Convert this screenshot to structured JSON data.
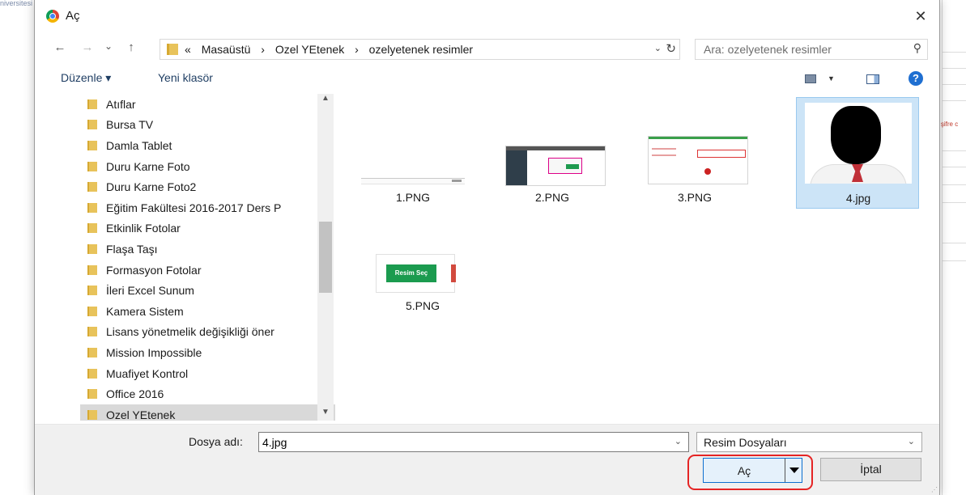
{
  "background": {
    "title": "niversitesi - Özel Yetenek Başvuru Sistemi",
    "cut_text": "r şifre c"
  },
  "dialog": {
    "title": "Aç",
    "close_glyph": "✕",
    "nav": {
      "back": "←",
      "forward": "→",
      "recent": "⌄",
      "up": "↑"
    },
    "address": {
      "prefix": "«",
      "crumbs": [
        "Masaüstü",
        "›",
        "Ozel YEtenek",
        "›",
        "ozelyetenek resimler"
      ],
      "dropdown_glyph": "⌄",
      "refresh_glyph": "↻"
    },
    "search": {
      "placeholder": "Ara: ozelyetenek resimler",
      "icon_glyph": "⚲"
    },
    "toolbar": {
      "organize": "Düzenle ▾",
      "new_folder": "Yeni klasör",
      "help": "?"
    },
    "tree": [
      "Atıflar",
      "Bursa TV",
      "Damla Tablet",
      "Duru Karne Foto",
      "Duru Karne Foto2",
      "Eğitim Fakültesi 2016-2017 Ders P",
      "Etkinlik Fotolar",
      "Flaşa Taşı",
      "Formasyon Fotolar",
      "İleri Excel Sunum",
      "Kamera Sistem",
      "Lisans yönetmelik değişikliği öner",
      "Mission Impossible",
      "Muafiyet Kontrol",
      "Office 2016",
      "Ozel YEtenek"
    ],
    "selected_folder": "Ozel YEtenek",
    "files": [
      {
        "name": "1.PNG"
      },
      {
        "name": "2.PNG"
      },
      {
        "name": "3.PNG"
      },
      {
        "name": "4.jpg",
        "selected": true
      },
      {
        "name": "5.PNG",
        "thumb_text": "Resim Seç"
      }
    ],
    "bottom": {
      "filename_label": "Dosya adı:",
      "filename_value": "4.jpg",
      "filetype": "Resim Dosyaları",
      "open": "Aç",
      "cancel": "İptal"
    }
  },
  "colors": {
    "accent": "#0d6fcf",
    "highlight_box": "#e52424",
    "selection": "#cce4f7",
    "folder": "#e8c35b"
  }
}
